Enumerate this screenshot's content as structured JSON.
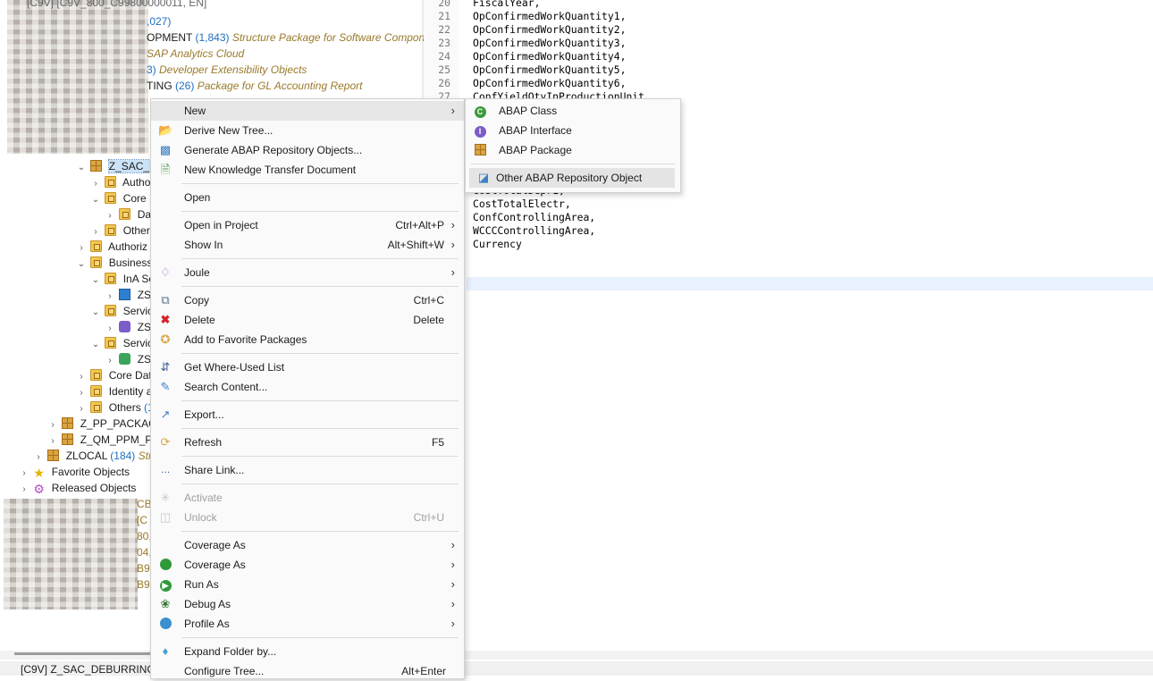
{
  "tree": {
    "header_text": "[C9V] [C9V_800_C99800000011, EN]",
    "rows": [
      {
        "text": ",027)"
      },
      {
        "label": "OPMENT",
        "count": "(1,843)",
        "desc": "Structure Package for Software Compone"
      },
      {
        "desc": "SAP Analytics Cloud"
      },
      {
        "count": "3)",
        "desc": "Developer Extensibility Objects"
      },
      {
        "label": "TING",
        "count": "(26)",
        "desc": "Package for GL Accounting Report"
      },
      {
        "label": "Z_SAC_D"
      },
      {
        "label": "Autho"
      },
      {
        "label": "Core D"
      },
      {
        "label": "Da"
      },
      {
        "label": "Other"
      },
      {
        "label": "Authoriz"
      },
      {
        "label": "Business"
      },
      {
        "label": "InA Se"
      },
      {
        "label": "ZSI"
      },
      {
        "label": "Servic"
      },
      {
        "label": "ZSI"
      },
      {
        "label": "Servic"
      },
      {
        "label": "ZSI"
      },
      {
        "label": "Core Dat"
      },
      {
        "label": "Identity a"
      },
      {
        "label": "Others",
        "count": "(1"
      },
      {
        "label": "Z_PP_PACKAGE"
      },
      {
        "label": "Z_QM_PPM_PA"
      },
      {
        "label": "ZLOCAL",
        "count": "(184)",
        "desc": "Str"
      },
      {
        "label": "Favorite Objects"
      },
      {
        "label": "Released Objects"
      },
      {
        "text": "CB"
      },
      {
        "text": "[C"
      },
      {
        "text": "80,"
      },
      {
        "text": "04,"
      },
      {
        "text": "B99"
      },
      {
        "text": "B9"
      }
    ]
  },
  "editor": {
    "lines": [
      {
        "n": "20",
        "code": "FiscalYear,"
      },
      {
        "n": "21",
        "code": "OpConfirmedWorkQuantity1,"
      },
      {
        "n": "22",
        "code": "OpConfirmedWorkQuantity2,"
      },
      {
        "n": "23",
        "code": "OpConfirmedWorkQuantity3,"
      },
      {
        "n": "24",
        "code": "OpConfirmedWorkQuantity4,"
      },
      {
        "n": "25",
        "code": "OpConfirmedWorkQuantity5,"
      },
      {
        "n": "26",
        "code": "OpConfirmedWorkQuantity6,"
      },
      {
        "n": "27",
        "code": "ConfYieldQtyInProductionUnit,"
      },
      {
        "n": "",
        "code": "CostTotalDepr1,"
      },
      {
        "n": "",
        "code": "CostTotalElectr,"
      },
      {
        "n": "",
        "code": "ConfControllingArea,"
      },
      {
        "n": "",
        "code": "WCCCControllingArea,"
      },
      {
        "n": "",
        "code": "Currency"
      }
    ]
  },
  "status": {
    "text": "[C9V] Z_SAC_DEBURRING"
  },
  "context_menu": {
    "new": "New",
    "derive": "Derive New Tree...",
    "generate": "Generate ABAP Repository Objects...",
    "knowledge": "New Knowledge Transfer Document",
    "open": "Open",
    "open_in_project": "Open in Project",
    "open_in_project_acc": "Ctrl+Alt+P",
    "show_in": "Show In",
    "show_in_acc": "Alt+Shift+W",
    "joule": "Joule",
    "copy": "Copy",
    "copy_acc": "Ctrl+C",
    "delete": "Delete",
    "delete_acc": "Delete",
    "favorite": "Add to Favorite Packages",
    "where_used": "Get Where-Used List",
    "search": "Search Content...",
    "export": "Export...",
    "refresh": "Refresh",
    "refresh_acc": "F5",
    "share": "Share Link...",
    "activate": "Activate",
    "unlock": "Unlock",
    "unlock_acc": "Ctrl+U",
    "coverage1": "Coverage As",
    "coverage2": "Coverage As",
    "run": "Run As",
    "debug": "Debug As",
    "profile": "Profile As",
    "expand": "Expand Folder by...",
    "configure": "Configure Tree...",
    "configure_acc": "Alt+Enter"
  },
  "submenu": {
    "abap_class": "ABAP Class",
    "abap_interface": "ABAP Interface",
    "abap_package": "ABAP Package",
    "other": "Other ABAP Repository Object"
  },
  "colors": {
    "count": "#1f6fbf",
    "description": "#9a7a2a",
    "highlight": "#e6e6e6",
    "selection": "#cce3f7"
  }
}
